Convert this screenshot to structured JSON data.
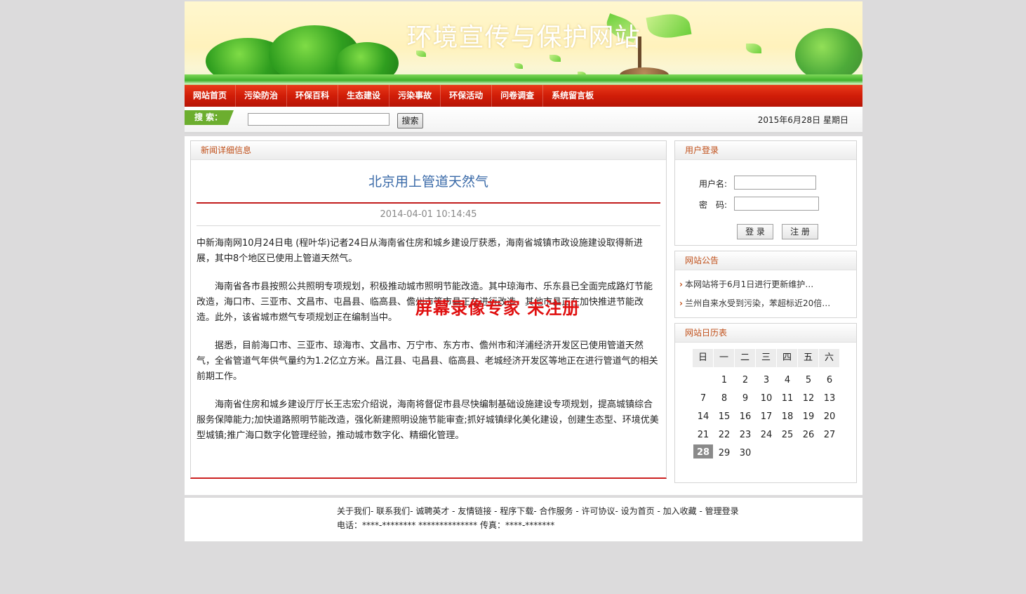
{
  "banner": {
    "title": "环境宣传与保护网站"
  },
  "nav": {
    "items": [
      "网站首页",
      "污染防治",
      "环保百科",
      "生态建设",
      "污染事故",
      "环保活动",
      "问卷调查",
      "系统留言板"
    ]
  },
  "search": {
    "label": "搜 索：",
    "value": "",
    "button": "搜索",
    "date": "2015年6月28日 星期日"
  },
  "news": {
    "panel_title": "新闻详细信息",
    "headline": "北京用上管道天然气",
    "timestamp": "2014-04-01 10:14:45",
    "paragraphs": [
      "中新海南网10月24日电 (程叶华)记者24日从海南省住房和城乡建设厅获悉，海南省城镇市政设施建设取得新进展，其中8个地区已使用上管道天然气。",
      "海南省各市县按照公共照明专项规划，积极推动城市照明节能改造。其中琼海市、乐东县已全面完成路灯节能改造，海口市、三亚市、文昌市、屯昌县、临高县、儋州市等市县正在进行改造，其他市县正在加快推进节能改造。此外，该省城市燃气专项规划正在编制当中。",
      "据悉，目前海口市、三亚市、琼海市、文昌市、万宁市、东方市、儋州市和洋浦经济开发区已使用管道天然气，全省管道气年供气量约为1.2亿立方米。昌江县、屯昌县、临高县、老城经济开发区等地正在进行管道气的相关前期工作。",
      "海南省住房和城乡建设厅厅长王志宏介绍说，海南将督促市县尽快编制基础设施建设专项规划，提高城镇综合服务保障能力;加快道路照明节能改造，强化新建照明设施节能审查;抓好城镇绿化美化建设，创建生态型、环境优美型城镇;推广海口数字化管理经验，推动城市数字化、精细化管理。"
    ],
    "watermark": "屏幕录像专家 未注册"
  },
  "login": {
    "panel_title": "用户登录",
    "username_label": "用户名:",
    "password_label": "密　码:",
    "username_value": "",
    "password_value": "",
    "login_button": "登 录",
    "register_button": "注 册"
  },
  "notice": {
    "panel_title": "网站公告",
    "items": [
      "本网站将于6月1日进行更新维护…",
      "兰州自来水受到污染，苯超标近20倍…"
    ]
  },
  "calendar": {
    "panel_title": "网站日历表",
    "weekdays": [
      "日",
      "一",
      "二",
      "三",
      "四",
      "五",
      "六"
    ],
    "first_weekday": 1,
    "days_in_month": 30,
    "today": 28
  },
  "footer": {
    "links": [
      "关于我们",
      "联系我们",
      "诚聘英才",
      "友情链接",
      "程序下载",
      "合作服务",
      "许可协议",
      "设为首页",
      "加入收藏",
      "管理登录"
    ],
    "separators": [
      "- ",
      "- ",
      " - ",
      " - ",
      "- ",
      " - ",
      "- ",
      " - ",
      " - "
    ],
    "contact": "电话：****-******** ************** 传真：****-*******"
  },
  "colors": {
    "nav_red": "#d11d08",
    "headline_blue": "#3a6aa8",
    "panel_title_orange": "#c0501a",
    "search_green": "#6cae2f",
    "watermark_red": "#e01010"
  }
}
